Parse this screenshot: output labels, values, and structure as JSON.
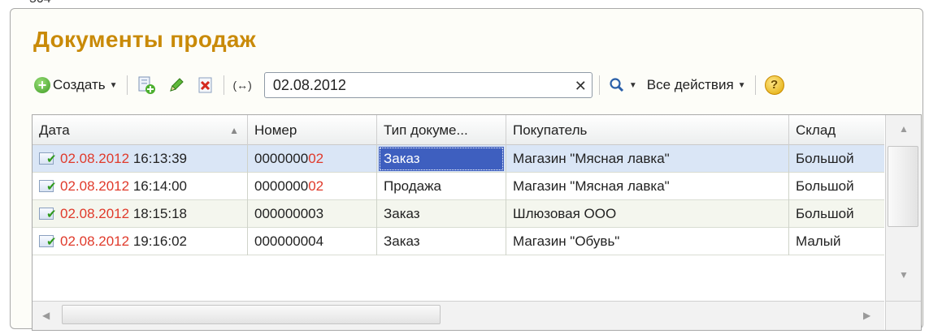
{
  "top_fragment": "504",
  "form": {
    "title": "Документы продаж"
  },
  "toolbar": {
    "create_label": "Создать",
    "search_value": "02.08.2012",
    "all_actions_label": "Все действия",
    "help_label": "?"
  },
  "table": {
    "columns": [
      "Дата",
      "Номер",
      "Тип докуме...",
      "Покупатель",
      "Склад"
    ],
    "rows": [
      {
        "date": "02.08.2012",
        "time": " 16:13:39",
        "num_prefix": "0000000",
        "num_suffix": "02",
        "type": "Заказ",
        "buyer": "Магазин \"Мясная лавка\"",
        "warehouse": "Большой"
      },
      {
        "date": "02.08.2012",
        "time": " 16:14:00",
        "num_prefix": "0000000",
        "num_suffix": "02",
        "type": "Продажа",
        "buyer": "Магазин \"Мясная лавка\"",
        "warehouse": "Большой"
      },
      {
        "date": "02.08.2012",
        "time": " 18:15:18",
        "num_prefix": "000000003",
        "num_suffix": "",
        "type": "Заказ",
        "buyer": "Шлюзовая ООО",
        "warehouse": "Большой"
      },
      {
        "date": "02.08.2012",
        "time": " 19:16:02",
        "num_prefix": "000000004",
        "num_suffix": "",
        "type": "Заказ",
        "buyer": "Магазин \"Обувь\"",
        "warehouse": "Малый"
      }
    ]
  },
  "colors": {
    "title": "#c98a08",
    "highlight": "#e03a2b",
    "selected_row": "#dae6f6",
    "focus_cell": "#3e5fbf"
  },
  "icons": [
    "add-icon",
    "copy-icon",
    "edit-icon",
    "delete-icon",
    "expand-icon",
    "search-icon",
    "help-icon",
    "document-posted-icon"
  ]
}
